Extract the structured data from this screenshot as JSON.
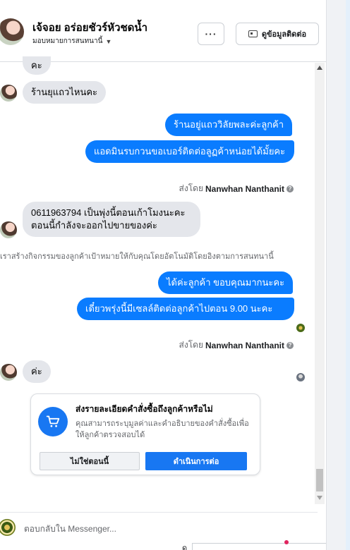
{
  "header": {
    "contact_name": "เจ้จอย อร่อยชัวร์หัวชดน้ำ",
    "assign_label": "มอบหมายการสนทนานี้",
    "more_label": "···",
    "contact_info_label": "ดูข้อมูลติดต่อ"
  },
  "messages": {
    "in_1": "คะ",
    "in_2": "ร้านยุแถวไหนคะ",
    "out_1": "ร้านอยู่แถววิลัยพละค่ะลูกค้า",
    "out_2": "แอดมินรบกวนขอเบอร์ติดต่อลูฏค้าหน่อยได้มั้ยคะ",
    "sent_by_prefix": "ส่งโดย",
    "sent_by_name": "Nanwhan Nanthanit",
    "in_3": "0611963794 เป็นพุ่งนี้ตอนเก้าโมงนะคะ ตอนนี้กำลังจะออกไปขายของค่ะ",
    "system_note": "เราสร้างกิจกรรมของลูกค้าเป้าหมายให้กับคุณโดยอัตโนมัติโดยอิงตามการสนทนานี้",
    "out_3": "ได้ค่ะลูกค้า ขอบคุณมากนะคะ",
    "out_4": "เดี๋ยวพรุ่งนี้มีเซลล์ติดต่อลูกค้าไปตอน 9.00 นะคะ",
    "in_4": "ค่ะ"
  },
  "order_card": {
    "title": "ส่งรายละเอียดคำสั่งซื้อถึงลูกค้าหรือไม่",
    "description": "คุณสามารถระบุมูลค่าและคำอธิบายของคำสั่งซื้อเพื่อให้ลูกค้าตรวจสอบได้",
    "decline_label": "ไม่ใช่ตอนนี้",
    "proceed_label": "ดำเนินการต่อ",
    "icon": "shopping-cart-icon"
  },
  "composer": {
    "placeholder": "ตอบกลับใน Messenger...",
    "bottom_fragment": "ด"
  },
  "colors": {
    "outgoing_bubble": "#0a7cff",
    "incoming_bubble": "#e4e6eb",
    "primary_button": "#1877f2"
  }
}
